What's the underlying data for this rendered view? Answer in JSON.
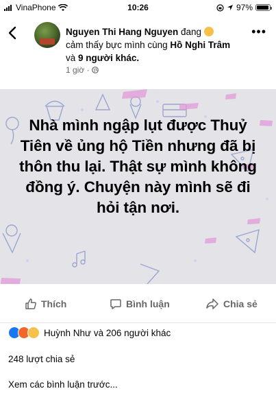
{
  "status_bar": {
    "carrier": "VinaPhone",
    "time": "10:26",
    "battery": "97%"
  },
  "post": {
    "author": "Nguyen Thi Hang Nguyen",
    "feeling_prefix": "đang",
    "feeling_text": "cảm thấy bực mình cùng",
    "tagged": "Hồ Nghi Trâm",
    "tag_connector": "và",
    "others": "9 người khác.",
    "time": "1 giờ",
    "separator": "·",
    "text": "Nhà mình ngập lụt được Thuỷ Tiên về ủng hộ Tiền nhưng đã bị thôn thu lại. Thật sự mình không đồng ý. Chuyện này mình sẽ đi hỏi tận nơi."
  },
  "actions": {
    "like": "Thích",
    "comment": "Bình luận",
    "share": "Chia sẻ"
  },
  "stats": {
    "reactions": "Huỳnh Như và 206 người khác",
    "shares": "248 lượt chia sẻ",
    "more_comments": "Xem các bình luận trước..."
  },
  "colors": {
    "like_blue": "#1877f2",
    "angry_orange": "#f0662b",
    "haha_yellow": "#f7c04b",
    "secondary_text": "#65676b"
  },
  "icons": [
    "back-chevron-icon",
    "more-icon",
    "globe-icon",
    "like-icon",
    "comment-icon",
    "share-icon"
  ]
}
